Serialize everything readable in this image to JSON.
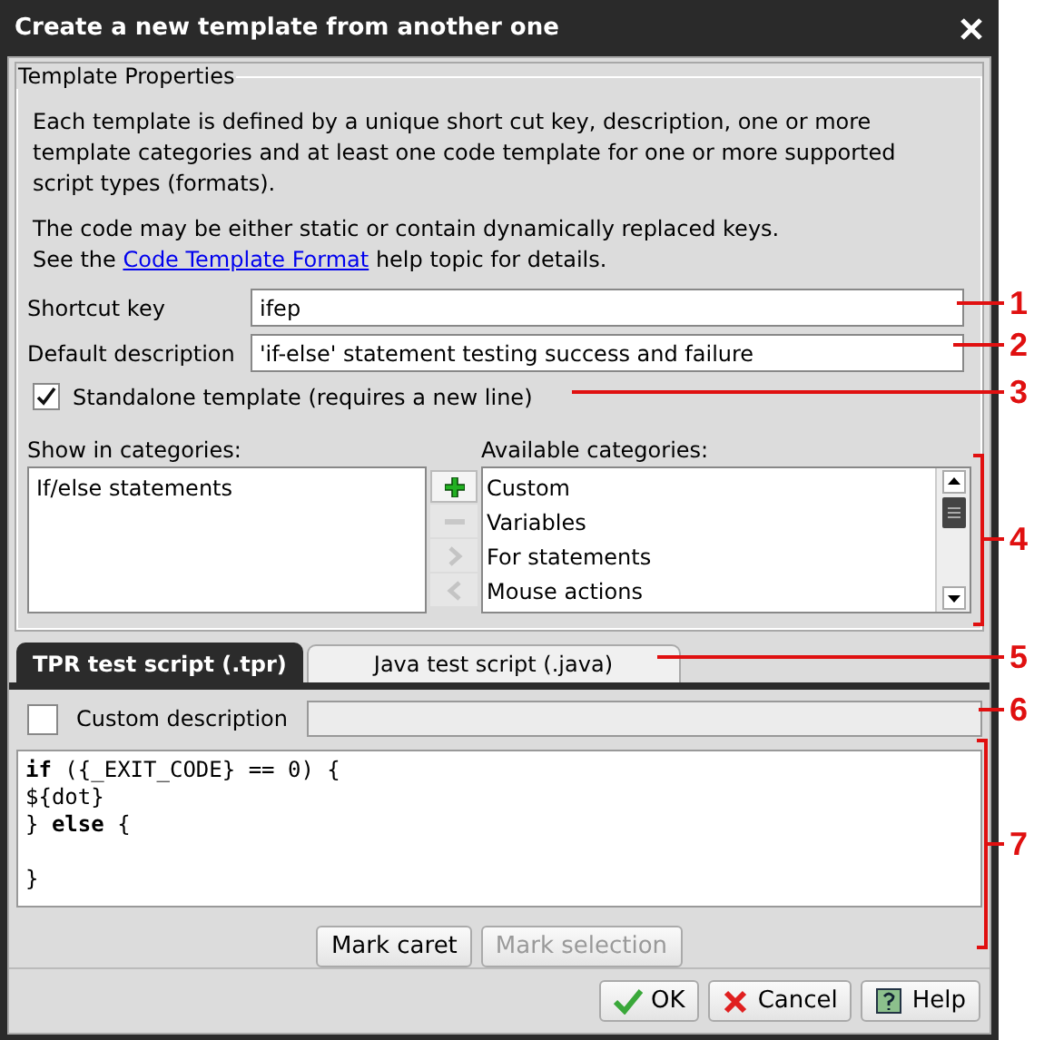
{
  "window": {
    "title": "Create a new template from another one"
  },
  "properties": {
    "title": "Template Properties",
    "intro": "Each template is defined by a unique short cut key, description, one or more template categories and at least one code template for one or more supported script types (formats).",
    "help_before": "The code may be either static or contain dynamically replaced keys.\nSee the ",
    "help_link": "Code Template Format",
    "help_after": " help topic for details.",
    "shortcut_key": {
      "label": "Shortcut key",
      "value": "ifep"
    },
    "default_description": {
      "label": "Default description",
      "value": "'if-else' statement testing success and failure"
    },
    "standalone": {
      "label": "Standalone template (requires a new line)",
      "checked": true
    },
    "show_in": {
      "label": "Show in categories:",
      "items": [
        {
          "label": "If/else statements"
        }
      ]
    },
    "transfer_buttons": [
      {
        "kind": "add",
        "disabled": false
      },
      {
        "kind": "remove",
        "disabled": true
      },
      {
        "kind": "right",
        "disabled": true
      },
      {
        "kind": "left",
        "disabled": true
      }
    ],
    "available": {
      "label": "Available categories:",
      "items": [
        {
          "label": "Custom"
        },
        {
          "label": "Variables"
        },
        {
          "label": "For statements"
        },
        {
          "label": "Mouse actions"
        }
      ]
    }
  },
  "tabs": [
    {
      "label": "TPR test script (.tpr)",
      "selected": true
    },
    {
      "label": "Java test script (.java)",
      "selected": false
    }
  ],
  "editor": {
    "custom_description": {
      "label": "Custom description",
      "checked": false
    },
    "code": "**if** ({_EXIT_CODE} == 0) {\n${dot}\n} **else** {\n\n}",
    "buttons": [
      {
        "label": "Mark caret",
        "disabled": false
      },
      {
        "label": "Mark selection",
        "disabled": true
      }
    ]
  },
  "buttons": [
    {
      "kind": "ok",
      "label": "OK"
    },
    {
      "kind": "cancel",
      "label": "Cancel"
    },
    {
      "kind": "help",
      "label": "Help"
    }
  ],
  "callouts": [
    {
      "number": "1"
    },
    {
      "number": "2"
    },
    {
      "number": "3"
    },
    {
      "number": "4"
    },
    {
      "number": "5"
    },
    {
      "number": "6"
    },
    {
      "number": "7"
    }
  ]
}
